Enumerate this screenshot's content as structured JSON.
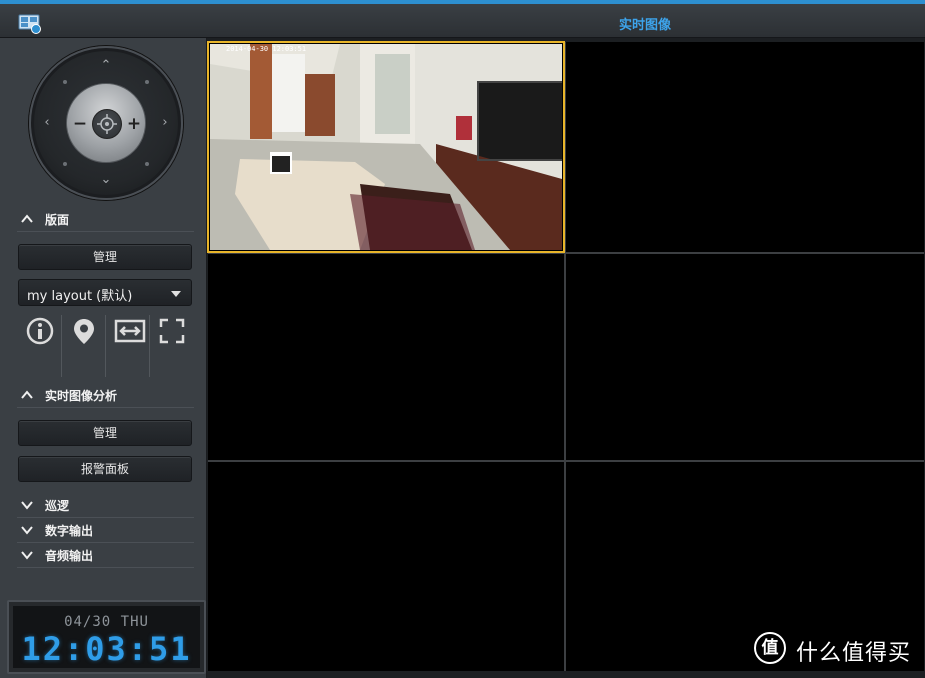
{
  "window": {
    "title": "实时图像"
  },
  "sidebar": {
    "layout_section": {
      "label": "版面"
    },
    "layout_manage_button": "管理",
    "layout_select": {
      "value": "my layout (默认)"
    },
    "tools": [
      "info-icon",
      "map-pin-icon",
      "fit-width-icon",
      "fullscreen-icon"
    ],
    "analytics_section": {
      "label": "实时图像分析"
    },
    "analytics_manage_button": "管理",
    "alarm_panel_button": "报警面板",
    "collapsed_sections": [
      {
        "label": "巡逻"
      },
      {
        "label": "数字输出"
      },
      {
        "label": "音频输出"
      }
    ]
  },
  "clock": {
    "date": "04/30 THU",
    "time": "12:03:51"
  },
  "grid": {
    "active_channel": 1,
    "osd_text": "2014-04-30 12:03:51"
  },
  "watermark": {
    "text": "什么值得买",
    "logo": "值"
  },
  "colors": {
    "accent": "#3da4ec",
    "selection": "#e8b52a",
    "clock": "#2f9de8"
  }
}
